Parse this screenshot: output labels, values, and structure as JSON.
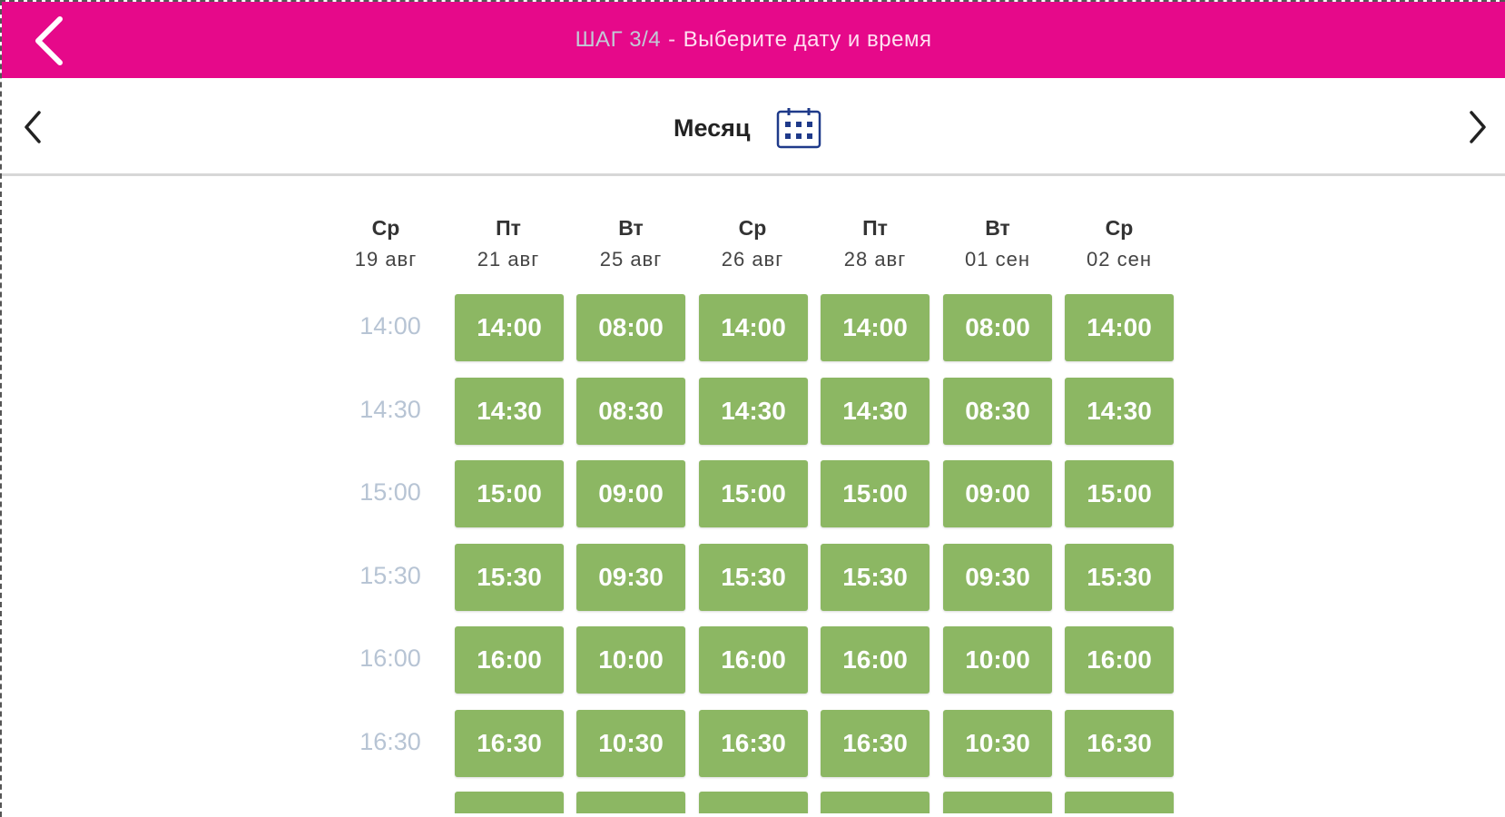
{
  "header": {
    "step": "ШАГ 3/4",
    "separator": "-",
    "title": "Выберите дату и время",
    "back_icon": "chevron-left-icon",
    "color": "#e6098a"
  },
  "nav": {
    "prev_icon": "chevron-left-icon",
    "next_icon": "chevron-right-icon",
    "view_label": "Месяц",
    "calendar_icon": "calendar-grid-icon"
  },
  "columns": [
    {
      "dow": "Ср",
      "date": "19 авг"
    },
    {
      "dow": "Пт",
      "date": "21 авг"
    },
    {
      "dow": "Вт",
      "date": "25 авг"
    },
    {
      "dow": "Ср",
      "date": "26 авг"
    },
    {
      "dow": "Пт",
      "date": "28 авг"
    },
    {
      "dow": "Вт",
      "date": "01 сен"
    },
    {
      "dow": "Ср",
      "date": "02 сен"
    }
  ],
  "rows": [
    {
      "label": "14:00",
      "slots": [
        "14:00",
        "08:00",
        "14:00",
        "14:00",
        "08:00",
        "14:00"
      ]
    },
    {
      "label": "14:30",
      "slots": [
        "14:30",
        "08:30",
        "14:30",
        "14:30",
        "08:30",
        "14:30"
      ]
    },
    {
      "label": "15:00",
      "slots": [
        "15:00",
        "09:00",
        "15:00",
        "15:00",
        "09:00",
        "15:00"
      ]
    },
    {
      "label": "15:30",
      "slots": [
        "15:30",
        "09:30",
        "15:30",
        "15:30",
        "09:30",
        "15:30"
      ]
    },
    {
      "label": "16:00",
      "slots": [
        "16:00",
        "10:00",
        "16:00",
        "16:00",
        "10:00",
        "16:00"
      ]
    },
    {
      "label": "16:30",
      "slots": [
        "16:30",
        "10:30",
        "16:30",
        "16:30",
        "10:30",
        "16:30"
      ]
    }
  ],
  "colors": {
    "slot": "#8cb763",
    "disabled_time": "#b7c4d4"
  }
}
